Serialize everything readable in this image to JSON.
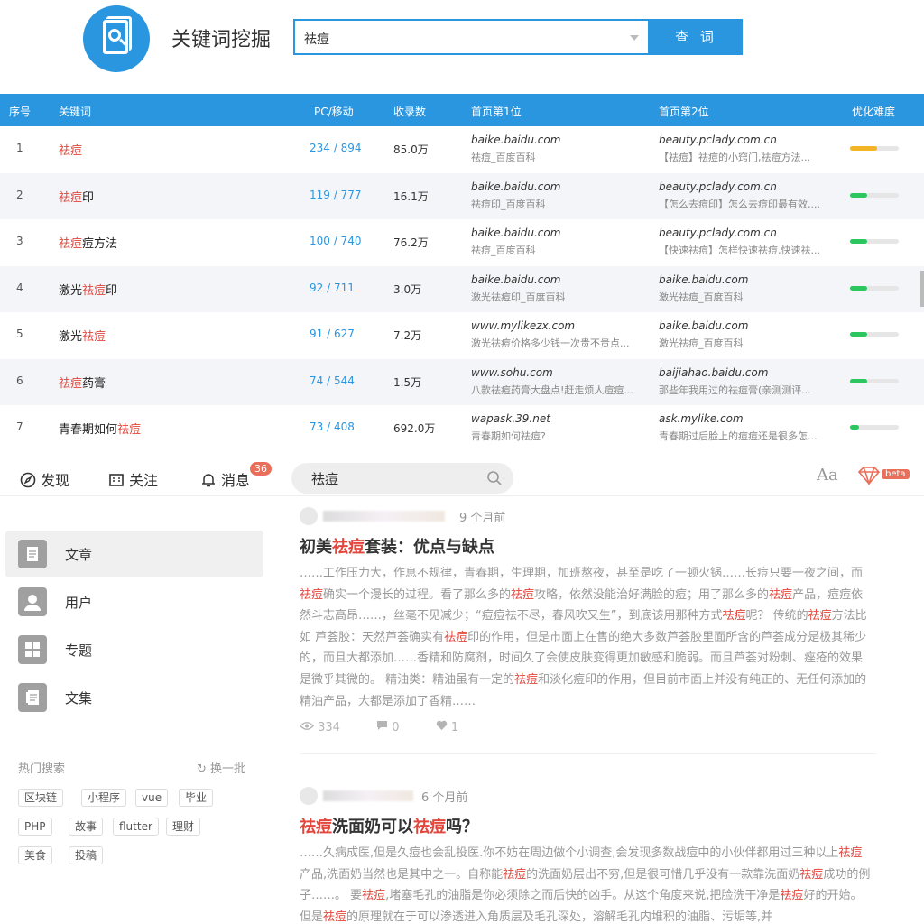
{
  "tool": {
    "title": "关键词挖掘",
    "query": "祛痘",
    "search_button": "查 词",
    "columns": [
      "序号",
      "关键词",
      "PC/移动",
      "收录数",
      "首页第1位",
      "首页第2位",
      "优化难度"
    ],
    "rows": [
      {
        "no": "1",
        "kw_pre": "",
        "kw_hl": "祛痘",
        "kw_post": "",
        "pc": "234 / 894",
        "count": "85.0万",
        "s1_site": "baike.baidu.com",
        "s1_desc": "祛痘_百度百科",
        "s2_site": "beauty.pclady.com.cn",
        "s2_desc": "【祛痘】祛痘的小窍门,祛痘方法...",
        "difficulty": 0.55,
        "difficulty_color": "#f3b425"
      },
      {
        "no": "2",
        "kw_pre": "",
        "kw_hl": "祛痘",
        "kw_post": "印",
        "pc": "119 / 777",
        "count": "16.1万",
        "s1_site": "baike.baidu.com",
        "s1_desc": "祛痘印_百度百科",
        "s2_site": "beauty.pclady.com.cn",
        "s2_desc": "【怎么去痘印】怎么去痘印最有效,...",
        "difficulty": 0.35,
        "difficulty_color": "#2cc65f"
      },
      {
        "no": "3",
        "kw_pre": "",
        "kw_hl": "祛痘",
        "kw_post": "痘方法",
        "pc": "100 / 740",
        "count": "76.2万",
        "s1_site": "baike.baidu.com",
        "s1_desc": "祛痘_百度百科",
        "s2_site": "beauty.pclady.com.cn",
        "s2_desc": "【快速祛痘】怎样快速祛痘,快速祛...",
        "difficulty": 0.35,
        "difficulty_color": "#2cc65f"
      },
      {
        "no": "4",
        "kw_pre": "激光",
        "kw_hl": "祛痘",
        "kw_post": "印",
        "pc": "92 / 711",
        "count": "3.0万",
        "s1_site": "baike.baidu.com",
        "s1_desc": "激光祛痘印_百度百科",
        "s2_site": "baike.baidu.com",
        "s2_desc": "激光祛痘_百度百科",
        "difficulty": 0.35,
        "difficulty_color": "#2cc65f"
      },
      {
        "no": "5",
        "kw_pre": "激光",
        "kw_hl": "祛痘",
        "kw_post": "",
        "pc": "91 / 627",
        "count": "7.2万",
        "s1_site": "www.mylikezx.com",
        "s1_desc": "激光祛痘价格多少钱一次贵不贵点...",
        "s2_site": "baike.baidu.com",
        "s2_desc": "激光祛痘_百度百科",
        "difficulty": 0.35,
        "difficulty_color": "#2cc65f"
      },
      {
        "no": "6",
        "kw_pre": "",
        "kw_hl": "祛痘",
        "kw_post": "药膏",
        "pc": "74 / 544",
        "count": "1.5万",
        "s1_site": "www.sohu.com",
        "s1_desc": "八款祛痘药膏大盘点!赶走烦人痘痘...",
        "s2_site": "baijiahao.baidu.com",
        "s2_desc": "那些年我用过的祛痘膏(亲测测评...",
        "difficulty": 0.35,
        "difficulty_color": "#2cc65f"
      },
      {
        "no": "7",
        "kw_pre": "青春期如何",
        "kw_hl": "祛痘",
        "kw_post": "",
        "pc": "73 / 408",
        "count": "692.0万",
        "s1_site": "wapask.39.net",
        "s1_desc": "青春期如何祛痘?",
        "s2_site": "ask.mylike.com",
        "s2_desc": "青春期过后脸上的痘痘还是很多怎...",
        "difficulty": 0.18,
        "difficulty_color": "#2cc65f"
      }
    ]
  },
  "site": {
    "nav": {
      "discover": "发现",
      "follow": "关注",
      "messages": "消息",
      "message_count": "36",
      "search_value": "祛痘",
      "font_toggle": "Aa",
      "beta": "beta"
    },
    "sidebar": {
      "items": [
        {
          "label": "文章"
        },
        {
          "label": "用户"
        },
        {
          "label": "专题"
        },
        {
          "label": "文集"
        }
      ],
      "hot_title": "热门搜索",
      "hot_refresh": "换一批",
      "tags": [
        "区块链",
        "小程序",
        "vue",
        "毕业",
        "PHP",
        "故事",
        "flutter",
        "理财",
        "美食",
        "投稿"
      ]
    },
    "articles": [
      {
        "time": "9 个月前",
        "title_parts": [
          "初美",
          "祛痘",
          "套装：优点与缺点"
        ],
        "body": [
          {
            "t": "……工作压力大，作息不规律，青春期，生理期，加班熬夜，甚至是吃了一顿火锅……长痘只要一夜之间，而",
            "h": false
          },
          {
            "t": "祛痘",
            "h": true
          },
          {
            "t": "确实一个漫长的过程。看了那么多的",
            "h": false
          },
          {
            "t": "祛痘",
            "h": true
          },
          {
            "t": "攻略，依然没能治好满脸的痘；用了那么多的",
            "h": false
          },
          {
            "t": "祛痘",
            "h": true
          },
          {
            "t": "产品，痘痘依然斗志高昂……，丝毫不见减少；“痘痘祛不尽，春风吹又生”，到底该用那种方式",
            "h": false
          },
          {
            "t": "祛痘",
            "h": true
          },
          {
            "t": "呢？ 传统的",
            "h": false
          },
          {
            "t": "祛痘",
            "h": true
          },
          {
            "t": "方法比如 芦荟胶：天然芦荟确实有",
            "h": false
          },
          {
            "t": "祛痘",
            "h": true
          },
          {
            "t": "印的作用，但是市面上在售的绝大多数芦荟胶里面所含的芦荟成分是极其稀少的，而且大都添加……香精和防腐剂，时间久了会使皮肤变得更加敏感和脆弱。而且芦荟对粉刺、痤疮的效果是微乎其微的。 精油类：精油虽有一定的",
            "h": false
          },
          {
            "t": "祛痘",
            "h": true
          },
          {
            "t": "和淡化痘印的作用，但目前市面上并没有纯正的、无任何添加的精油产品，大都是添加了香精……",
            "h": false
          }
        ],
        "views": "334",
        "comments": "0",
        "likes": "1"
      },
      {
        "time": "6 个月前",
        "title_parts": [
          "",
          "祛痘",
          "洗面奶可以",
          "祛痘",
          "吗？"
        ],
        "body": [
          {
            "t": "……久病成医,但是久痘也会乱投医.你不妨在周边做个小调查,会发现多数战痘中的小伙伴都用过三种以上",
            "h": false
          },
          {
            "t": "祛痘",
            "h": true
          },
          {
            "t": "产品,洗面奶当然也是其中之一。自称能",
            "h": false
          },
          {
            "t": "祛痘",
            "h": true
          },
          {
            "t": "的洗面奶层出不穷,但是很可惜几乎没有一款靠洗面奶",
            "h": false
          },
          {
            "t": "祛痘",
            "h": true
          },
          {
            "t": "成功的例子……。 要",
            "h": false
          },
          {
            "t": "祛痘",
            "h": true
          },
          {
            "t": ",堵塞毛孔的油脂是你必须除之而后快的凶手。从这个角度来说,把脸洗干净是",
            "h": false
          },
          {
            "t": "祛痘",
            "h": true
          },
          {
            "t": "好的开始。但是",
            "h": false
          },
          {
            "t": "祛痘",
            "h": true
          },
          {
            "t": "的原理就在于可以渗透进入角质层及毛孔深处，溶解毛孔内堆积的油脂、污垢等,并",
            "h": false
          }
        ]
      }
    ]
  }
}
